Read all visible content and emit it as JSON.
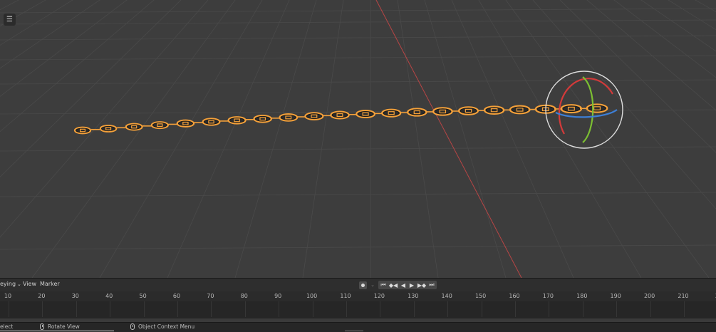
{
  "viewport": {
    "header_icon": "list-icon",
    "colors": {
      "background": "#3d3d3d",
      "grid": "#4a4a4a",
      "axis_x": "#b84545",
      "selection_outline": "#f5a13a",
      "gizmo_ring": "#dddddd",
      "gizmo_x": "#d33a3a",
      "gizmo_y": "#7cbf32",
      "gizmo_z": "#3d7fd6"
    }
  },
  "timeline": {
    "menu": {
      "keying": "eying",
      "view": "View",
      "marker": "Marker"
    },
    "playback": {
      "record_icon": "record-icon",
      "jump_start": "⏮",
      "prev_key": "◆◀",
      "play_reverse": "◀",
      "play": "▶",
      "next_key": "▶◆",
      "jump_end": "⏭"
    },
    "ruler": [
      "10",
      "20",
      "30",
      "40",
      "50",
      "60",
      "70",
      "80",
      "90",
      "100",
      "110",
      "120",
      "130",
      "140",
      "150",
      "160",
      "170",
      "180",
      "190",
      "200",
      "210",
      "2"
    ]
  },
  "statusbar": {
    "select": "elect",
    "rotate_view": "Rotate View",
    "context_menu": "Object Context Menu"
  }
}
